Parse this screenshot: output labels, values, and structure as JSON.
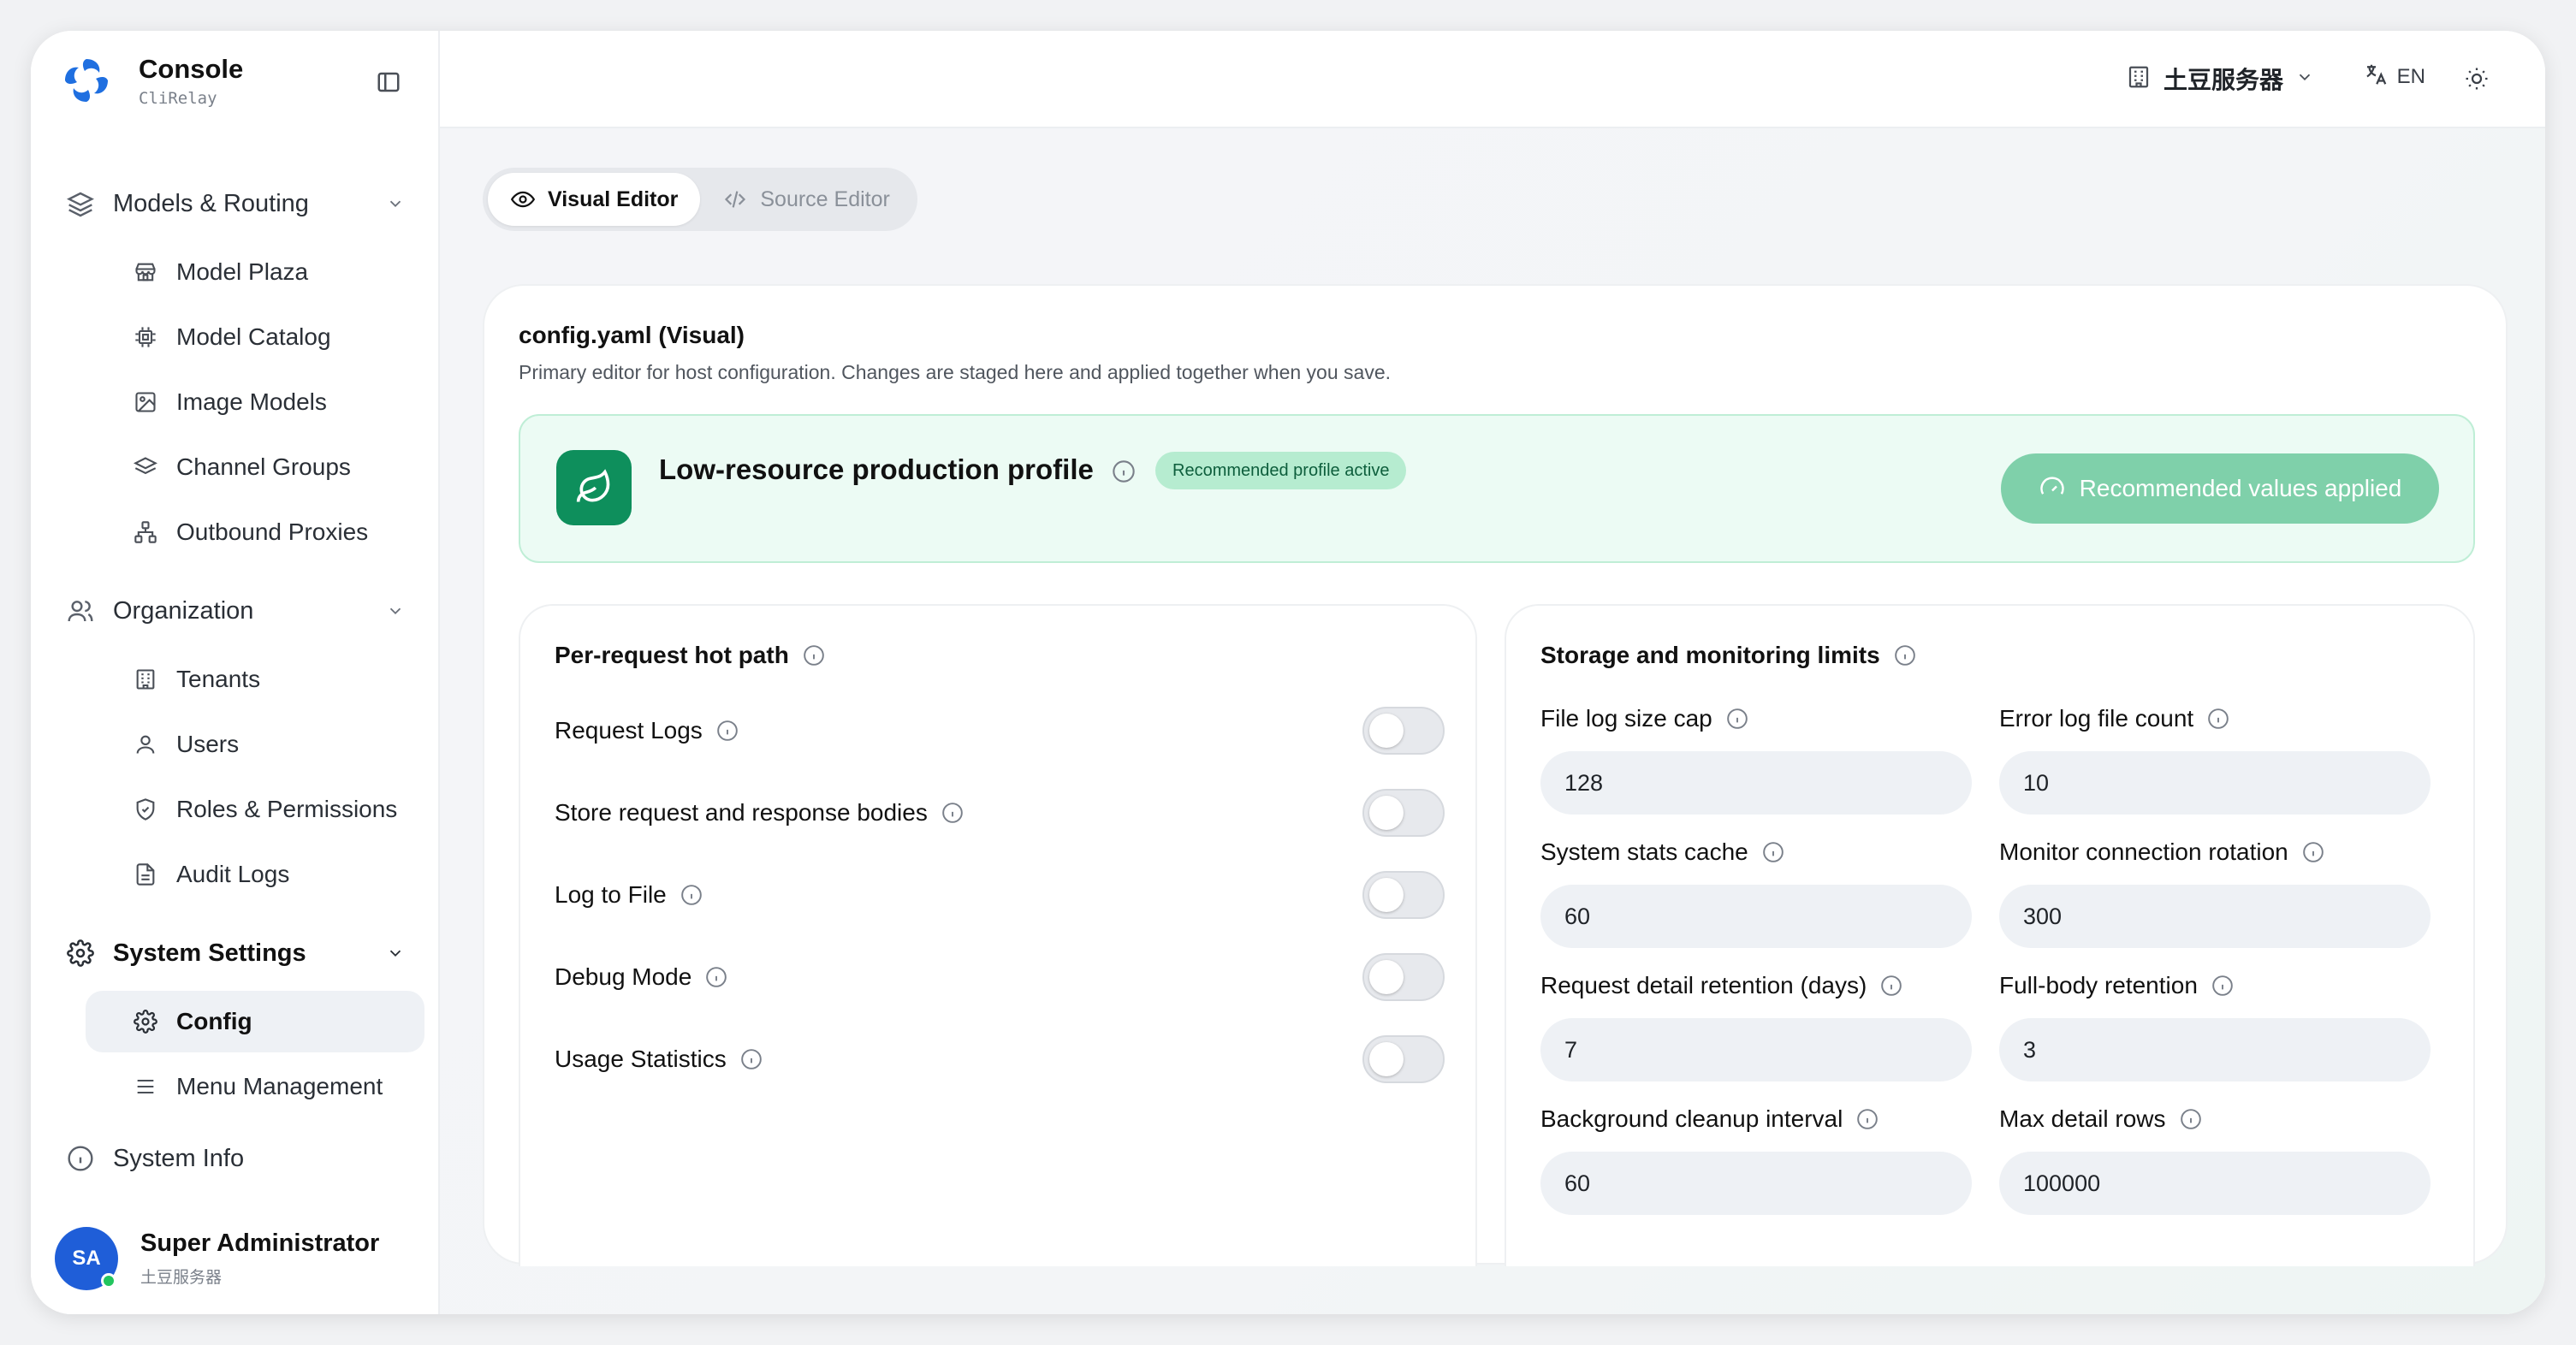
{
  "brand": {
    "title": "Console",
    "subtitle": "CliRelay"
  },
  "sidebar": {
    "groups": [
      {
        "label": "Models & Routing",
        "icon": "layers-icon",
        "items": [
          {
            "label": "Model Plaza",
            "icon": "store-icon"
          },
          {
            "label": "Model Catalog",
            "icon": "chip-icon"
          },
          {
            "label": "Image Models",
            "icon": "image-icon"
          },
          {
            "label": "Channel Groups",
            "icon": "layers-icon"
          },
          {
            "label": "Outbound Proxies",
            "icon": "network-icon"
          }
        ]
      },
      {
        "label": "Organization",
        "icon": "users-icon",
        "items": [
          {
            "label": "Tenants",
            "icon": "building-icon"
          },
          {
            "label": "Users",
            "icon": "user-icon"
          },
          {
            "label": "Roles & Permissions",
            "icon": "shield-icon"
          },
          {
            "label": "Audit Logs",
            "icon": "document-icon"
          }
        ]
      },
      {
        "label": "System Settings",
        "icon": "gear-icon",
        "items": [
          {
            "label": "Config",
            "icon": "gear-icon",
            "active": true
          },
          {
            "label": "Menu Management",
            "icon": "menu-icon"
          }
        ]
      }
    ],
    "system_info": {
      "label": "System Info",
      "icon": "info-icon"
    }
  },
  "user": {
    "initials": "SA",
    "name": "Super Administrator",
    "org": "土豆服务器"
  },
  "topbar": {
    "tenant": "土豆服务器",
    "language": "EN"
  },
  "editor_tabs": [
    {
      "label": "Visual Editor",
      "icon": "eye-icon",
      "active": true
    },
    {
      "label": "Source Editor",
      "icon": "code-icon",
      "active": false
    }
  ],
  "config": {
    "title": "config.yaml (Visual)",
    "description": "Primary editor for host configuration. Changes are staged here and applied together when you save.",
    "profile": {
      "name": "Low-resource production profile",
      "badge": "Recommended profile active",
      "button": "Recommended values applied"
    },
    "hot_path": {
      "title": "Per-request hot path",
      "toggles": [
        {
          "label": "Request Logs",
          "on": false
        },
        {
          "label": "Store request and response bodies",
          "on": false
        },
        {
          "label": "Log to File",
          "on": false
        },
        {
          "label": "Debug Mode",
          "on": false
        },
        {
          "label": "Usage Statistics",
          "on": false
        }
      ]
    },
    "limits": {
      "title": "Storage and monitoring limits",
      "fields": [
        {
          "label": "File log size cap",
          "value": "128"
        },
        {
          "label": "Error log file count",
          "value": "10"
        },
        {
          "label": "System stats cache",
          "value": "60"
        },
        {
          "label": "Monitor connection rotation",
          "value": "300"
        },
        {
          "label": "Request detail retention (days)",
          "value": "7"
        },
        {
          "label": "Full-body retention",
          "value": "3"
        },
        {
          "label": "Background cleanup interval",
          "value": "60"
        },
        {
          "label": "Max detail rows",
          "value": "100000"
        }
      ]
    }
  },
  "colors": {
    "accent_green": "#0e8f5c",
    "avatar_blue": "#1f5ed8",
    "brand_blue": "#1f6fe0"
  }
}
